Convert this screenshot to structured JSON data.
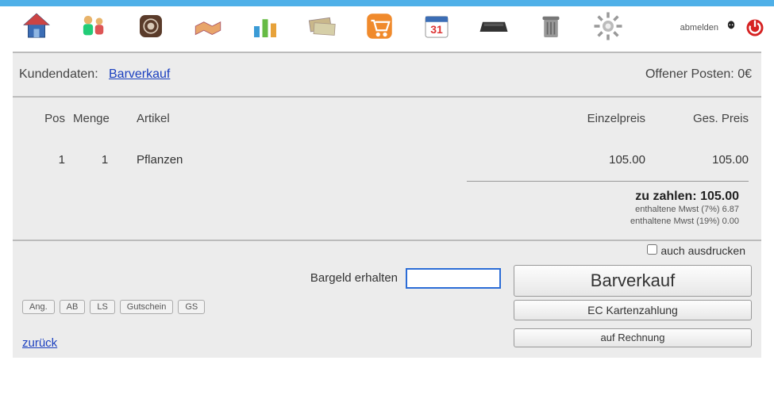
{
  "toolbar": {
    "home": "home-icon",
    "customers": "people-icon",
    "product": "box-icon",
    "deal": "handshake-icon",
    "stats": "chart-icon",
    "money": "cash-icon",
    "cart": "cart-icon",
    "calendar": "calendar-icon",
    "drawer": "cash-drawer-icon",
    "trash": "trash-icon",
    "settings": "gear-icon",
    "logout_label": "abmelden"
  },
  "header": {
    "kundendaten_label": "Kundendaten:",
    "kundendaten_link": "Barverkauf",
    "offener_label": "Offener Posten:",
    "offener_value": "0€"
  },
  "table": {
    "headers": {
      "pos": "Pos",
      "menge": "Menge",
      "artikel": "Artikel",
      "einzel": "Einzelpreis",
      "gesamt": "Ges. Preis"
    },
    "rows": [
      {
        "pos": "1",
        "menge": "1",
        "artikel": "Pflanzen",
        "einzel": "105.00",
        "gesamt": "105.00"
      }
    ]
  },
  "totals": {
    "zu_zahlen_label": "zu zahlen:",
    "zu_zahlen_value": "105.00",
    "vat7": "enthaltene Mwst (7%) 6.87",
    "vat19": "enthaltene Mwst (19%) 0.00"
  },
  "payment": {
    "print_label": "auch ausdrucken",
    "cash_label": "Bargeld erhalten",
    "cash_value": "",
    "mini": {
      "ang": "Ang.",
      "ab": "AB",
      "ls": "LS",
      "gutschein": "Gutschein",
      "gs": "GS"
    },
    "back": "zurück",
    "barverkauf": "Barverkauf",
    "ec": "EC Kartenzahlung",
    "rechnung": "auf Rechnung"
  }
}
